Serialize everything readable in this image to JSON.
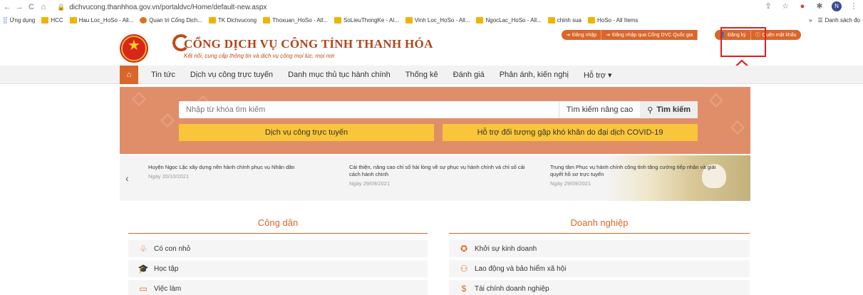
{
  "browser": {
    "url": "dichvucong.thanhhoa.gov.vn/portaldvc/Home/default-new.aspx",
    "bookmarks": [
      {
        "label": "Ứng dụng"
      },
      {
        "label": "HCC"
      },
      {
        "label": "Hau Loc_HoSo - All..."
      },
      {
        "label": "Quan tri Cổng Dịch..."
      },
      {
        "label": "TK Dichvucong"
      },
      {
        "label": "Thoxuan_HoSo - All..."
      },
      {
        "label": "SoLieuThongKe - Al..."
      },
      {
        "label": "Vinh Loc_HoSo - All..."
      },
      {
        "label": "NgocLac_HoSo - All..."
      },
      {
        "label": "chinh sua"
      },
      {
        "label": "HoSo - All Items"
      }
    ],
    "bookmarks_right": "Danh sách đọ",
    "more_bookmarks": "»",
    "avatar_letter": "N"
  },
  "header": {
    "title": "CỔNG DỊCH VỤ CÔNG TỈNH THANH HÓA",
    "subtitle": "Kết nối, cung cấp thông tin và dịch vụ công mọi lúc, mọi nơi",
    "top_links": [
      {
        "label": "Đăng nhập"
      },
      {
        "label": "Đăng nhập qua Cổng DVC Quốc gia"
      },
      {
        "label": "Đăng ký"
      },
      {
        "label": "Quên mật khẩu"
      }
    ]
  },
  "nav": {
    "items": [
      {
        "label": "Tin tức"
      },
      {
        "label": "Dịch vụ công trực tuyến"
      },
      {
        "label": "Danh mục thủ tục hành chính"
      },
      {
        "label": "Thống kê"
      },
      {
        "label": "Đánh giá"
      },
      {
        "label": "Phản ánh, kiến nghị"
      },
      {
        "label": "Hỗ trợ ▾"
      }
    ]
  },
  "search": {
    "placeholder": "Nhập từ khóa tìm kiếm",
    "advanced": "Tìm kiếm nâng cao",
    "button": "Tìm kiếm"
  },
  "actions": {
    "online_services": "Dịch vụ công trực tuyến",
    "covid_support": "Hỗ trợ đối tượng gặp khó khăn do đại dịch COVID-19"
  },
  "news": [
    {
      "title": "Huyện Ngọc Lặc xây dựng nền hành chính phục vụ Nhân dân",
      "date": "Ngày 20/10/2021"
    },
    {
      "title": "Cải thiện, nâng cao chỉ số hài lòng về sự phục vụ hành chính và chỉ số cải cách hành chính",
      "date": "Ngày 29/09/2021"
    },
    {
      "title": "Trung tâm Phục vụ hành chính công tỉnh tăng cường tiếp nhận và giải quyết hồ sơ trực tuyến",
      "date": "Ngày 29/09/2021"
    }
  ],
  "citizen": {
    "title": "Công dân",
    "items": [
      {
        "label": "Có con nhỏ"
      },
      {
        "label": "Học tập"
      },
      {
        "label": "Việc làm"
      }
    ]
  },
  "business": {
    "title": "Doanh nghiệp",
    "items": [
      {
        "label": "Khởi sự kinh doanh"
      },
      {
        "label": "Lao động và bảo hiểm xã hội"
      },
      {
        "label": "Tài chính doanh nghiệp"
      }
    ]
  },
  "colors": {
    "brand_orange": "#d9662a",
    "title_red": "#b3431a",
    "yellow": "#f9c53a",
    "highlight_red": "#e31c1c"
  }
}
